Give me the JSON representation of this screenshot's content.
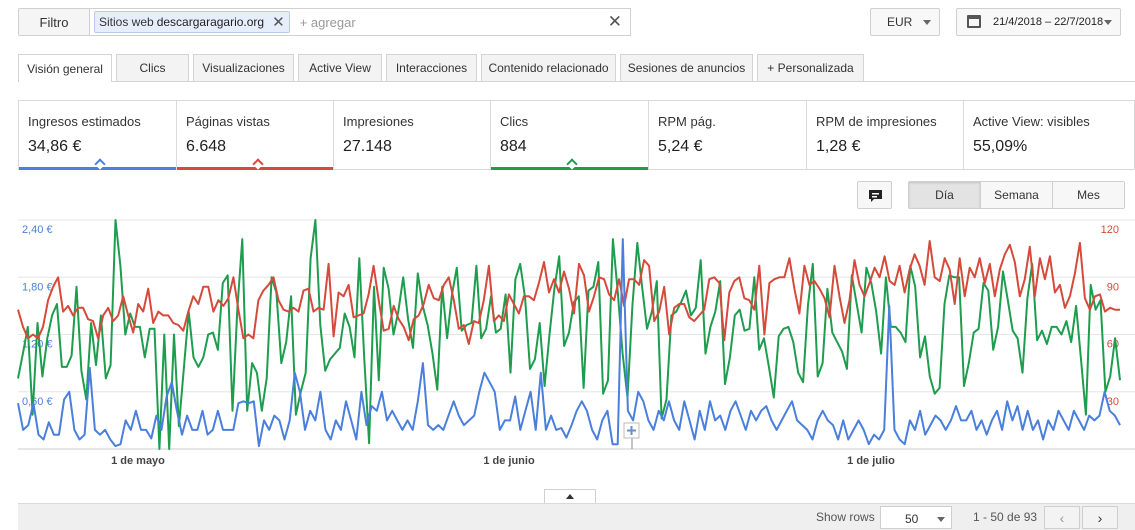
{
  "filter": {
    "label": "Filtro",
    "chip_prefix": "Sitios web",
    "chip_value": "descargaragario.org",
    "add_placeholder": "+ agregar"
  },
  "currency": "EUR",
  "date_range": "21/4/2018 – 22/7/2018",
  "tabs": [
    "Visión general",
    "Clics",
    "Visualizaciones",
    "Active View",
    "Interacciones",
    "Contenido relacionado",
    "Sesiones de anuncios",
    "+ Personalizada"
  ],
  "active_tab": "Visión general",
  "metrics": [
    {
      "label": "Ingresos estimados",
      "value": "34,86 €",
      "color": "#4a7fdb",
      "selected": true
    },
    {
      "label": "Páginas vistas",
      "value": "6.648",
      "color": "#d64a3b",
      "selected": true
    },
    {
      "label": "Impresiones",
      "value": "27.148",
      "selected": false
    },
    {
      "label": "Clics",
      "value": "884",
      "color": "#1e9d4e",
      "selected": true
    },
    {
      "label": "RPM pág.",
      "value": "5,24 €",
      "selected": false
    },
    {
      "label": "RPM de impresiones",
      "value": "1,28 €",
      "selected": false
    },
    {
      "label": "Active View: visibles",
      "value": "55,09%",
      "selected": false
    }
  ],
  "period_buttons": [
    "Día",
    "Semana",
    "Mes"
  ],
  "active_period": "Día",
  "chart_data": {
    "type": "line",
    "x_labels": [
      "1 de mayo",
      "1 de junio",
      "1 de julio"
    ],
    "left_axis": {
      "ticks": [
        "2,40 €",
        "1,80 €",
        "1,20 €",
        "0,60 €"
      ],
      "tick_values": [
        2.4,
        1.8,
        1.2,
        0.6
      ],
      "range": [
        0,
        2.4
      ]
    },
    "right_axis": {
      "ticks": [
        "120",
        "90",
        "60",
        "30"
      ],
      "tick_values": [
        120,
        90,
        60,
        30
      ],
      "range": [
        0,
        120
      ]
    },
    "series": [
      {
        "color": "#1e9d4e",
        "axis": "right",
        "values": [
          37,
          50,
          64,
          18,
          66,
          38,
          58,
          70,
          76,
          43,
          43,
          49,
          85,
          41,
          26,
          66,
          44,
          70,
          37,
          44,
          120,
          96,
          60,
          71,
          64,
          64,
          48,
          63,
          63,
          0,
          60,
          0,
          60,
          12,
          42,
          72,
          48,
          43,
          48,
          60,
          61,
          52,
          87,
          91,
          20,
          74,
          110,
          20,
          45,
          40,
          20,
          37,
          90,
          82,
          45,
          56,
          80,
          18,
          30,
          40,
          100,
          120,
          65,
          41,
          47,
          50,
          53,
          71,
          64,
          48,
          100,
          48,
          3,
          85,
          36,
          95,
          84,
          60,
          72,
          90,
          68,
          53,
          92,
          75,
          65,
          50,
          31,
          85,
          58,
          81,
          95,
          62,
          65,
          66,
          96,
          58,
          63,
          80,
          61,
          63,
          81,
          40,
          89,
          97,
          79,
          42,
          47,
          66,
          33,
          60,
          84,
          101,
          54,
          61,
          77,
          80,
          32,
          83,
          85,
          98,
          29,
          36,
          110,
          82,
          50,
          27,
          75,
          108,
          85,
          63,
          72,
          88,
          16,
          26,
          70,
          72,
          77,
          83,
          70,
          74,
          99,
          50,
          64,
          72,
          88,
          34,
          48,
          70,
          73,
          62,
          63,
          90,
          52,
          58,
          43,
          27,
          59,
          63,
          64,
          56,
          40,
          35,
          75,
          97,
          38,
          45,
          84,
          61,
          56,
          51,
          42,
          91,
          76,
          61,
          95,
          87,
          72,
          50,
          90,
          64,
          64,
          61,
          56,
          96,
          85,
          48,
          59,
          38,
          29,
          32,
          76,
          91,
          90,
          90,
          33,
          45,
          61,
          63,
          87,
          83,
          52,
          64,
          93,
          78,
          62,
          58,
          40,
          79,
          97,
          57,
          62,
          55,
          64,
          64,
          60,
          67,
          56,
          75,
          47,
          18,
          86,
          73,
          78,
          30,
          38,
          58,
          36
        ]
      },
      {
        "color": "#d64a3b",
        "axis": "right",
        "values": [
          73,
          64,
          58,
          60,
          58,
          64,
          78,
          85,
          90,
          72,
          75,
          70,
          74,
          74,
          68,
          67,
          58,
          70,
          74,
          67,
          70,
          80,
          70,
          61,
          76,
          72,
          84,
          66,
          72,
          70,
          70,
          66,
          65,
          62,
          72,
          80,
          76,
          85,
          85,
          72,
          78,
          75,
          79,
          90,
          73,
          58,
          60,
          58,
          78,
          83,
          86,
          90,
          78,
          73,
          72,
          74,
          72,
          83,
          84,
          72,
          74,
          73,
          97,
          59,
          82,
          80,
          86,
          69,
          70,
          71,
          81,
          96,
          78,
          62,
          63,
          75,
          68,
          64,
          57,
          68,
          70,
          76,
          86,
          79,
          78,
          86,
          90,
          78,
          63,
          65,
          55,
          67,
          66,
          78,
          96,
          67,
          70,
          67,
          81,
          76,
          71,
          80,
          80,
          78,
          87,
          98,
          82,
          89,
          82,
          93,
          84,
          71,
          97,
          91,
          72,
          80,
          90,
          89,
          81,
          78,
          89,
          75,
          89,
          89,
          86,
          99,
          96,
          67,
          72,
          85,
          60,
          74,
          76,
          76,
          69,
          67,
          70,
          73,
          89,
          90,
          87,
          57,
          82,
          88,
          90,
          79,
          78,
          73,
          96,
          60,
          87,
          89,
          90,
          90,
          100,
          84,
          71,
          96,
          86,
          88,
          84,
          79,
          69,
          96,
          80,
          66,
          78,
          99,
          86,
          80,
          87,
          95,
          90,
          101,
          88,
          86,
          96,
          82,
          94,
          102,
          96,
          86,
          109,
          90,
          88,
          100,
          94,
          76,
          100,
          80,
          95,
          90,
          100,
          87,
          97,
          80,
          94,
          102,
          107,
          98,
          80,
          89,
          106,
          80,
          100,
          89,
          101,
          82,
          86,
          74,
          80,
          92,
          108,
          79,
          73,
          80,
          81,
          72,
          74,
          73,
          73
        ]
      },
      {
        "color": "#4a7fdb",
        "axis": "left",
        "values": [
          0.48,
          0.2,
          0.25,
          0.48,
          0.15,
          0.1,
          0.28,
          0.15,
          0.15,
          0.52,
          0.6,
          0.2,
          0.1,
          0.15,
          0.85,
          0.2,
          0.15,
          0.2,
          0.1,
          0.03,
          0.05,
          0.3,
          0.2,
          0.4,
          0.2,
          0.2,
          0.11,
          0.35,
          0.2,
          0.55,
          0.7,
          0.4,
          0.15,
          0.35,
          0.2,
          0.2,
          0.4,
          0.15,
          0.2,
          0.4,
          0.2,
          0.2,
          0.2,
          0.48,
          0.5,
          0.48,
          0.5,
          0.03,
          0.3,
          0.2,
          0.35,
          0.3,
          0.1,
          0.3,
          0.8,
          0.6,
          0.2,
          0.4,
          0.3,
          0.6,
          0.2,
          0.1,
          0.3,
          0.2,
          0.5,
          0.3,
          0.1,
          0.6,
          0.25,
          0.45,
          0.4,
          0.6,
          0.3,
          0.4,
          0.3,
          0.2,
          0.3,
          0.2,
          0.5,
          0.9,
          0.25,
          0.2,
          0.25,
          0.2,
          0.35,
          0.5,
          0.35,
          0.25,
          0.3,
          0.35,
          0.6,
          0.8,
          0.7,
          0.6,
          0.2,
          0.3,
          0.3,
          0.55,
          0.2,
          0.4,
          0.6,
          0.2,
          0.8,
          0.2,
          0.35,
          0.2,
          0.22,
          0.12,
          0.25,
          0.4,
          0.5,
          0.4,
          0.2,
          0.1,
          0.3,
          0.4,
          0.05,
          0.05,
          2.2,
          0.4,
          0.3,
          0.6,
          0.5,
          0.3,
          0.2,
          0.4,
          0.3,
          0.5,
          0.3,
          0.2,
          0.5,
          0.3,
          0.1,
          0.4,
          0.2,
          0.5,
          0.3,
          0.35,
          0.2,
          0.4,
          0.5,
          0.35,
          0.2,
          0.4,
          0.3,
          0.4,
          0.45,
          0.3,
          0.2,
          0.3,
          0.4,
          0.5,
          0.3,
          0.25,
          0.2,
          0.1,
          0.3,
          0.4,
          0.3,
          0.25,
          0.1,
          0.3,
          0.1,
          0.2,
          0.3,
          0.2,
          0.05,
          0.15,
          0.1,
          0.2,
          1.5,
          0.2,
          0.1,
          0.05,
          0.3,
          0.2,
          0.4,
          0.15,
          0.25,
          0.35,
          0.3,
          0.2,
          0.3,
          0.45,
          0.3,
          0.3,
          0.4,
          0.2,
          0.3,
          0.15,
          0.3,
          0.4,
          0.2,
          0.5,
          0.3,
          0.45,
          0.2,
          0.4,
          0.2,
          0.3,
          0.1,
          0.3,
          0.2,
          0.4,
          0.3,
          0.2,
          0.4,
          0.3,
          0.2,
          0.35,
          0.3,
          0.35,
          0.6,
          0.4,
          0.35,
          0.25
        ]
      }
    ]
  },
  "footer": {
    "show_rows_label": "Show rows",
    "rows_value": "50",
    "range_text": "1 - 50 de 93",
    "prev": "‹",
    "next": "›"
  }
}
